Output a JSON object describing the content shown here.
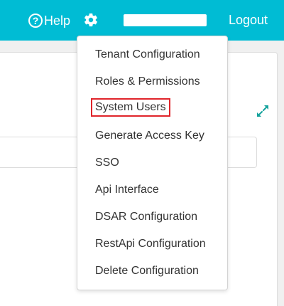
{
  "header": {
    "help_label": "Help",
    "help_icon_glyph": "?",
    "logout_label": "Logout",
    "bg_color": "#00bcd4"
  },
  "icons": {
    "help": "help-circle-icon",
    "settings": "gear-icon",
    "expand": "expand-arrows-icon"
  },
  "settings_menu": {
    "items": [
      {
        "label": "Tenant Configuration"
      },
      {
        "label": "Roles & Permissions"
      },
      {
        "label": "System Users",
        "highlighted": true
      },
      {
        "label": "Generate Access Key"
      },
      {
        "label": "SSO"
      },
      {
        "label": "Api Interface"
      },
      {
        "label": "DSAR Configuration"
      },
      {
        "label": "RestApi Configuration"
      },
      {
        "label": "Delete Configuration"
      }
    ],
    "highlight_color": "#e0252b"
  }
}
